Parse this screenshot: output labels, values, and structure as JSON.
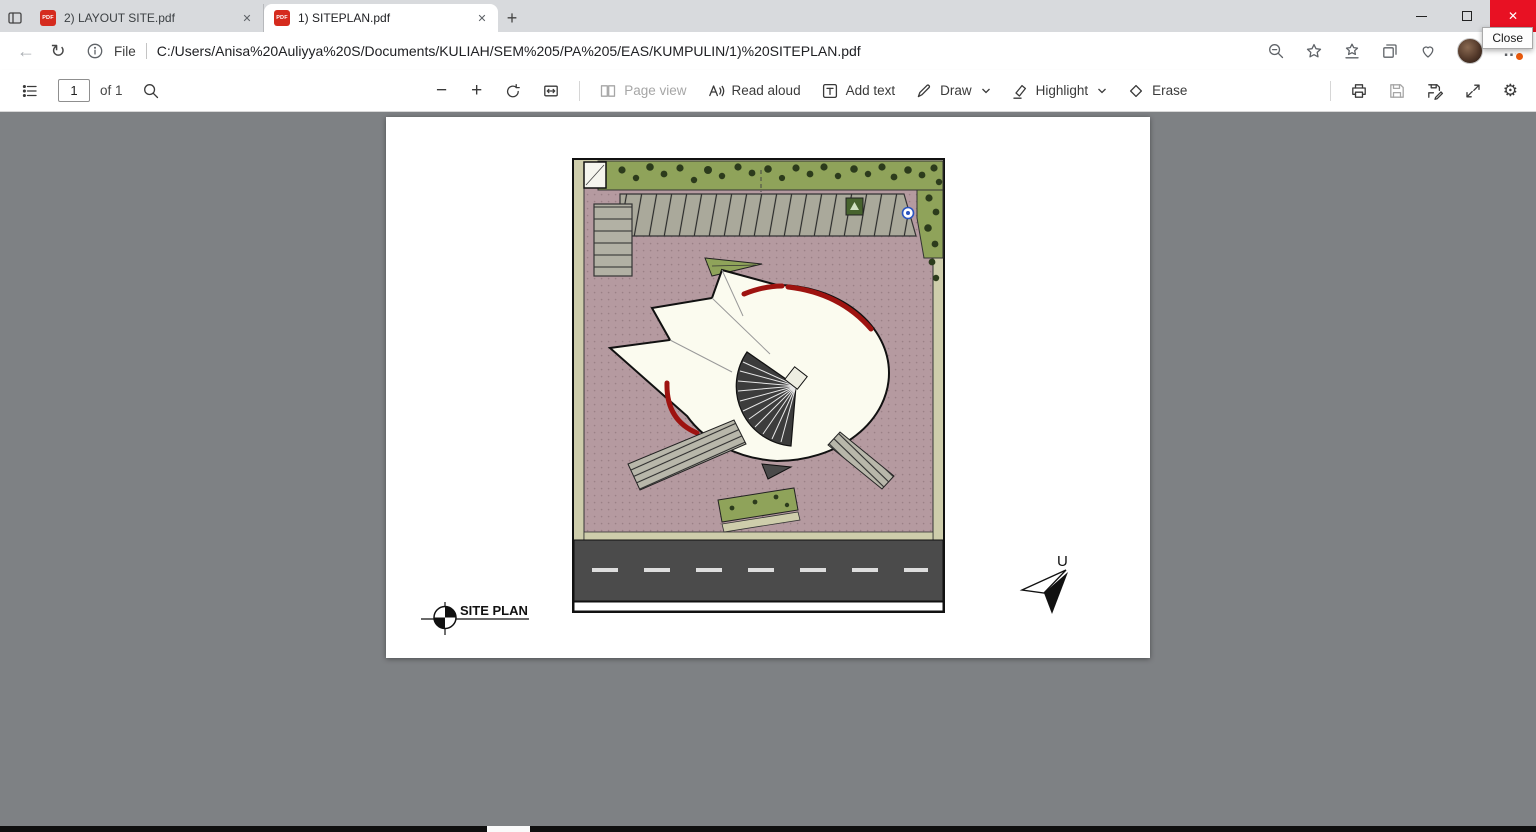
{
  "titlebar": {
    "tabs": [
      {
        "label": "2) LAYOUT SITE.pdf"
      },
      {
        "label": "1) SITEPLAN.pdf"
      }
    ],
    "pdf_badge": "PDF",
    "new_tab_glyph": "+",
    "close_glyph": "✕",
    "close_tooltip": "Close"
  },
  "addressbar": {
    "scheme_label": "File",
    "url": "C:/Users/Anisa%20Auliyya%20S/Documents/KULIAH/SEM%205/PA%205/EAS/KUMPULIN/1)%20SITEPLAN.pdf",
    "menu_glyph": "…"
  },
  "pdf_toolbar": {
    "page_number": "1",
    "page_count": "of 1",
    "zoom_out_glyph": "−",
    "zoom_in_glyph": "+",
    "page_view": "Page view",
    "read_aloud": "Read aloud",
    "add_text": "Add text",
    "draw": "Draw",
    "highlight": "Highlight",
    "erase": "Erase",
    "gear_glyph": "⚙"
  },
  "plan": {
    "title": "SITE PLAN",
    "north_label": "U"
  },
  "colors": {
    "close_button": "#e81123",
    "paving": "#b59aa0",
    "greenery": "#8fa35a",
    "road": "#4b4b4b",
    "frame": "#cecdab",
    "building": "#fbfbef",
    "red_accent": "#9e1310"
  }
}
